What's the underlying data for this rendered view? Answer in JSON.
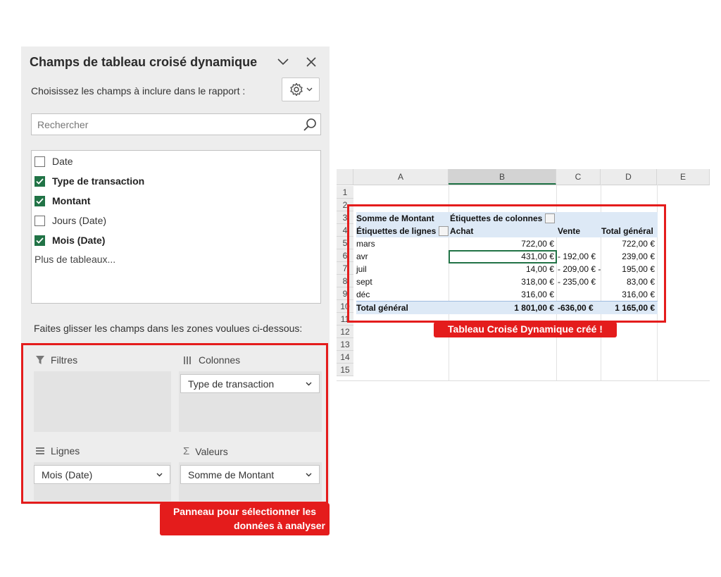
{
  "fields_panel": {
    "title": "Champs de tableau croisé dynamique",
    "instruction": "Choisissez les champs à inclure dans le rapport :",
    "search": {
      "placeholder": "Rechercher",
      "value": ""
    },
    "fields": [
      {
        "label": "Date",
        "checked": false
      },
      {
        "label": "Type de transaction",
        "checked": true
      },
      {
        "label": "Montant",
        "checked": true
      },
      {
        "label": "Jours (Date)",
        "checked": false
      },
      {
        "label": "Mois (Date)",
        "checked": true
      }
    ],
    "more_tables": "Plus de tableaux...",
    "drag_instruction": "Faites glisser les champs dans les zones voulues ci-dessous:",
    "zones": {
      "filters": {
        "label": "Filtres",
        "value": ""
      },
      "columns": {
        "label": "Colonnes",
        "value": "Type de transaction"
      },
      "rows": {
        "label": "Lignes",
        "value": "Mois (Date)"
      },
      "values": {
        "label": "Valeurs",
        "value": "Somme de Montant"
      }
    },
    "callout_line1": "Panneau pour sélectionner les",
    "callout_line2": "données à analyser"
  },
  "spreadsheet": {
    "column_headers": [
      "A",
      "B",
      "C",
      "D",
      "E"
    ],
    "active_column": "B",
    "row_numbers": [
      "1",
      "2",
      "3",
      "4",
      "5",
      "6",
      "7",
      "8",
      "9",
      "10",
      "11",
      "12",
      "13",
      "14",
      "15"
    ],
    "pivot": {
      "header_left": "Somme de Montant",
      "header_columns": "Étiquettes de colonnes",
      "row_labels_header": "Étiquettes de lignes",
      "col_achat": "Achat",
      "col_vente": "Vente",
      "col_total": "Total général",
      "rows": [
        {
          "label": "mars",
          "achat": "722,00 €",
          "vente": "",
          "total": "722,00 €"
        },
        {
          "label": "avr",
          "achat": "431,00 €",
          "vente": "- 192,00 €",
          "total": "239,00 €"
        },
        {
          "label": "juil",
          "achat": "14,00 €",
          "vente": "- 209,00 € -",
          "total": "195,00 €"
        },
        {
          "label": "sept",
          "achat": "318,00 €",
          "vente": "- 235,00 €",
          "total": "83,00 €"
        },
        {
          "label": "déc",
          "achat": "316,00 €",
          "vente": "",
          "total": "316,00 €"
        }
      ],
      "grand_total": {
        "label": "Total général",
        "achat": "1 801,00 €",
        "vente": "-636,00 €",
        "total": "1 165,00 €"
      }
    },
    "callout": "Tableau Croisé Dynamique créé !"
  },
  "colors": {
    "excel_green": "#217346",
    "highlight_red": "#e41c1c",
    "pivot_header_blue": "#dde9f6"
  },
  "icons": [
    "chevron-down-icon",
    "close-icon",
    "gear-icon",
    "search-icon",
    "checkbox-icon",
    "filter-icon",
    "columns-icon",
    "rows-icon",
    "sigma-icon",
    "dropdown-arrow-icon"
  ]
}
